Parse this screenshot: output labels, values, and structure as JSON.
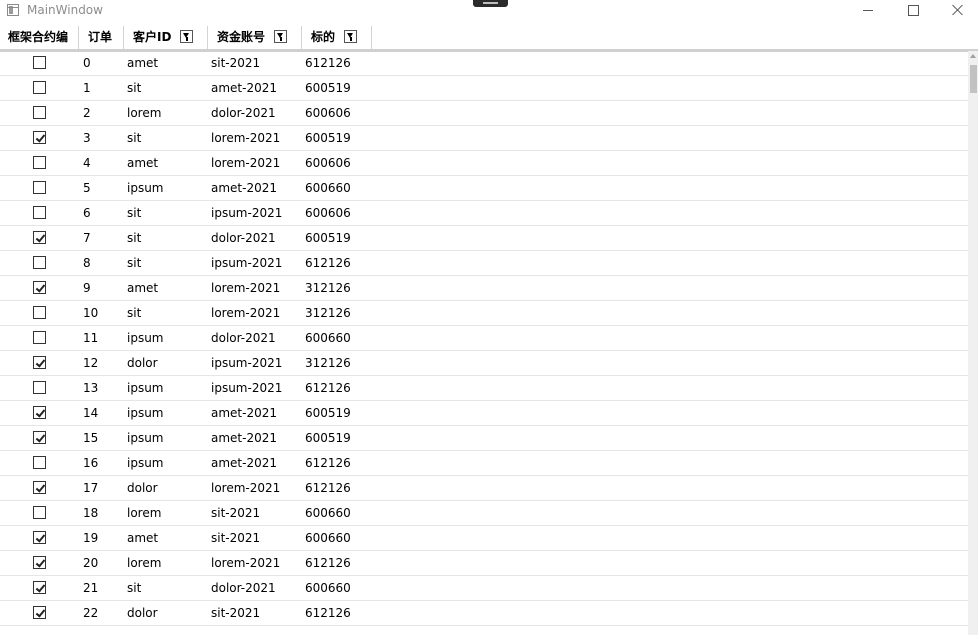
{
  "window": {
    "title": "MainWindow"
  },
  "columns": [
    {
      "label": "框架合约编",
      "filter": false
    },
    {
      "label": "订单",
      "filter": false
    },
    {
      "label": "客户ID",
      "filter": true
    },
    {
      "label": "资金账号",
      "filter": true
    },
    {
      "label": "标的",
      "filter": true
    }
  ],
  "rows": [
    {
      "checked": false,
      "order": "0",
      "client": "amet",
      "account": "sit-2021",
      "target": "612126"
    },
    {
      "checked": false,
      "order": "1",
      "client": "sit",
      "account": "amet-2021",
      "target": "600519"
    },
    {
      "checked": false,
      "order": "2",
      "client": "lorem",
      "account": "dolor-2021",
      "target": "600606"
    },
    {
      "checked": true,
      "order": "3",
      "client": "sit",
      "account": "lorem-2021",
      "target": "600519"
    },
    {
      "checked": false,
      "order": "4",
      "client": "amet",
      "account": "lorem-2021",
      "target": "600606"
    },
    {
      "checked": false,
      "order": "5",
      "client": "ipsum",
      "account": "amet-2021",
      "target": "600660"
    },
    {
      "checked": false,
      "order": "6",
      "client": "sit",
      "account": "ipsum-2021",
      "target": "600606"
    },
    {
      "checked": true,
      "order": "7",
      "client": "sit",
      "account": "dolor-2021",
      "target": "600519"
    },
    {
      "checked": false,
      "order": "8",
      "client": "sit",
      "account": "ipsum-2021",
      "target": "612126"
    },
    {
      "checked": true,
      "order": "9",
      "client": "amet",
      "account": "lorem-2021",
      "target": "312126"
    },
    {
      "checked": false,
      "order": "10",
      "client": "sit",
      "account": "lorem-2021",
      "target": "312126"
    },
    {
      "checked": false,
      "order": "11",
      "client": "ipsum",
      "account": "dolor-2021",
      "target": "600660"
    },
    {
      "checked": true,
      "order": "12",
      "client": "dolor",
      "account": "ipsum-2021",
      "target": "312126"
    },
    {
      "checked": false,
      "order": "13",
      "client": "ipsum",
      "account": "ipsum-2021",
      "target": "612126"
    },
    {
      "checked": true,
      "order": "14",
      "client": "ipsum",
      "account": "amet-2021",
      "target": "600519"
    },
    {
      "checked": true,
      "order": "15",
      "client": "ipsum",
      "account": "amet-2021",
      "target": "600519"
    },
    {
      "checked": false,
      "order": "16",
      "client": "ipsum",
      "account": "amet-2021",
      "target": "612126"
    },
    {
      "checked": true,
      "order": "17",
      "client": "dolor",
      "account": "lorem-2021",
      "target": "612126"
    },
    {
      "checked": false,
      "order": "18",
      "client": "lorem",
      "account": "sit-2021",
      "target": "600660"
    },
    {
      "checked": true,
      "order": "19",
      "client": "amet",
      "account": "sit-2021",
      "target": "600660"
    },
    {
      "checked": true,
      "order": "20",
      "client": "lorem",
      "account": "lorem-2021",
      "target": "612126"
    },
    {
      "checked": true,
      "order": "21",
      "client": "sit",
      "account": "dolor-2021",
      "target": "600660"
    },
    {
      "checked": true,
      "order": "22",
      "client": "dolor",
      "account": "sit-2021",
      "target": "612126"
    }
  ]
}
